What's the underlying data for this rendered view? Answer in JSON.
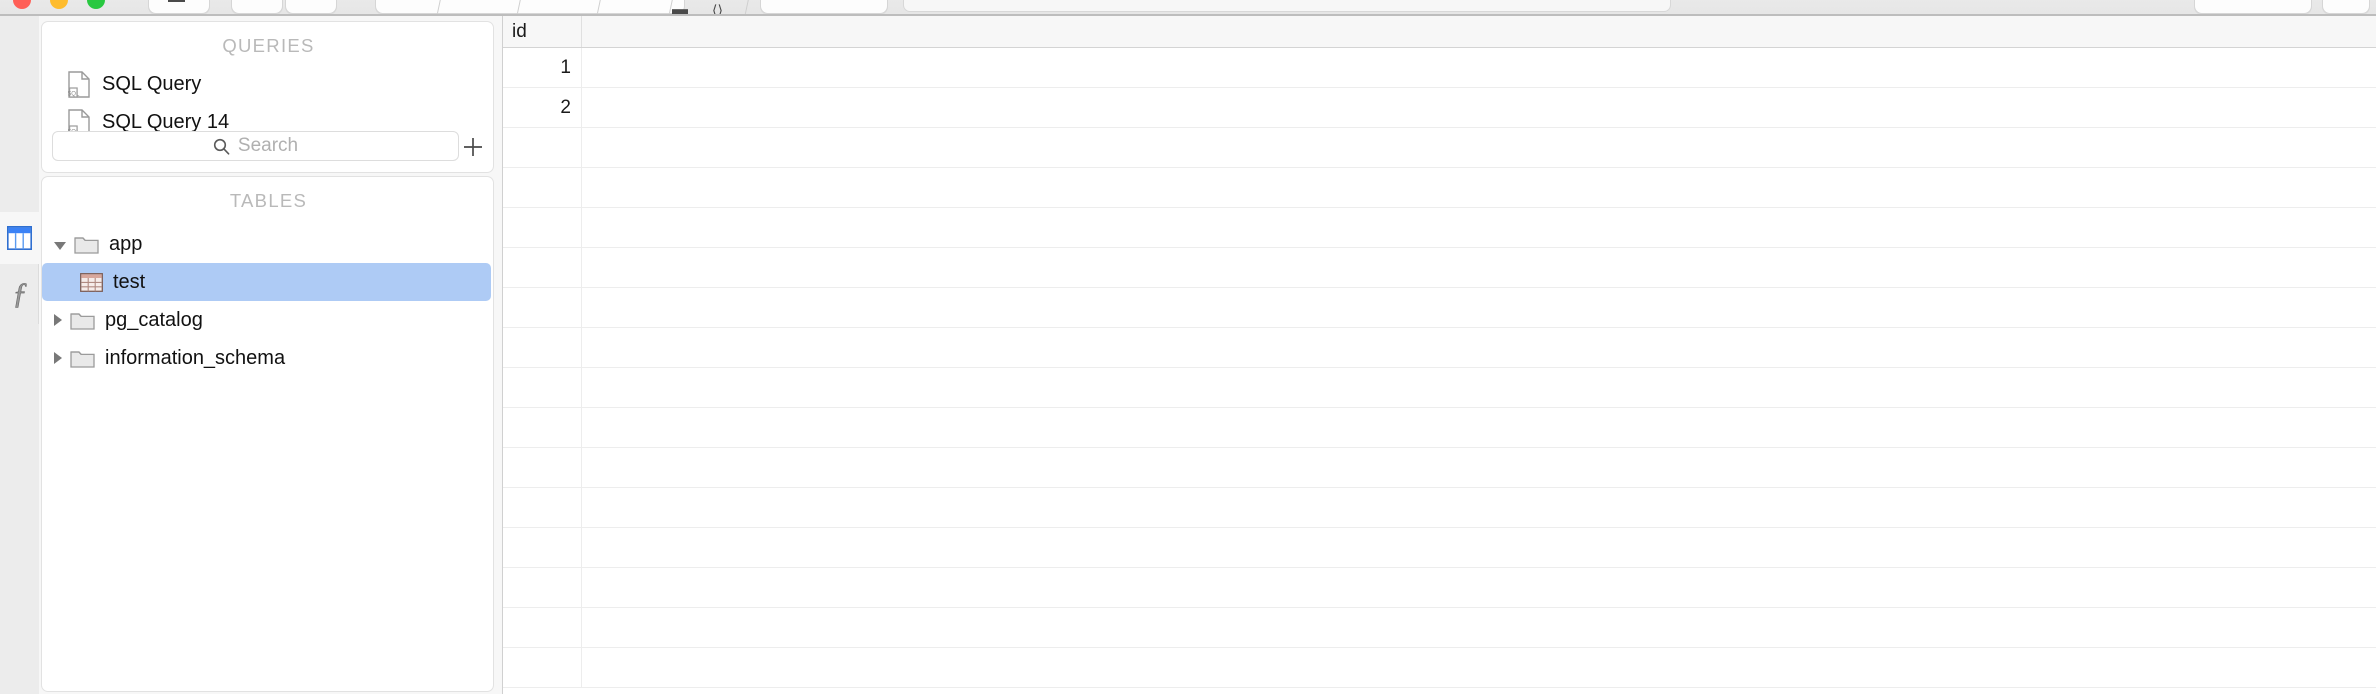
{
  "window": {
    "traffic_lights": [
      "close",
      "minimize",
      "zoom"
    ],
    "toolbar_items": [
      {
        "name": "sidebar-toggle",
        "glyph": "▭"
      },
      {
        "name": "nav-back",
        "glyph": "‹"
      },
      {
        "name": "nav-forward",
        "glyph": "›"
      },
      {
        "name": "view-table",
        "glyph": "⊞"
      },
      {
        "name": "structure",
        "glyph": "◎"
      },
      {
        "name": "relations",
        "glyph": "◆"
      },
      {
        "name": "content",
        "glyph": "▤"
      },
      {
        "name": "query-expand",
        "glyph": "⟨⟩"
      },
      {
        "name": "console",
        "glyph": "▬"
      },
      {
        "name": "filter",
        "glyph": "⌄"
      },
      {
        "name": "sort",
        "glyph": "⬤"
      },
      {
        "name": "refresh",
        "glyph": "▬"
      },
      {
        "name": "more",
        "glyph": "⌄"
      }
    ]
  },
  "rail": {
    "items": [
      {
        "name": "tables-tab",
        "icon": "grid-icon",
        "selected": true
      },
      {
        "name": "functions-tab",
        "icon": "function-f-icon",
        "selected": false
      }
    ]
  },
  "sidebar": {
    "queries": {
      "title": "QUERIES",
      "items": [
        {
          "label": "SQL Query",
          "icon": "sql-file-icon"
        },
        {
          "label": "SQL Query 14",
          "icon": "sql-file-icon"
        }
      ],
      "search": {
        "placeholder": "Search",
        "value": "",
        "icon": "search-icon"
      },
      "add_button": {
        "label": "+",
        "icon": "plus-icon"
      }
    },
    "tables": {
      "title": "TABLES",
      "tree": [
        {
          "label": "app",
          "type": "schema",
          "icon": "folder-icon",
          "expanded": true,
          "indent": 0,
          "selected": false
        },
        {
          "label": "test",
          "type": "table",
          "icon": "table-icon",
          "expanded": null,
          "indent": 1,
          "selected": true
        },
        {
          "label": "pg_catalog",
          "type": "schema",
          "icon": "folder-icon",
          "expanded": false,
          "indent": 0,
          "selected": false
        },
        {
          "label": "information_schema",
          "type": "schema",
          "icon": "folder-icon",
          "expanded": false,
          "indent": 0,
          "selected": false
        }
      ]
    }
  },
  "grid": {
    "columns": [
      "id",
      ""
    ],
    "rows": [
      [
        "1",
        ""
      ],
      [
        "2",
        ""
      ],
      [
        "",
        ""
      ],
      [
        "",
        ""
      ],
      [
        "",
        ""
      ],
      [
        "",
        ""
      ],
      [
        "",
        ""
      ],
      [
        "",
        ""
      ],
      [
        "",
        ""
      ],
      [
        "",
        ""
      ],
      [
        "",
        ""
      ],
      [
        "",
        ""
      ],
      [
        "",
        ""
      ],
      [
        "",
        ""
      ],
      [
        "",
        ""
      ],
      [
        "",
        ""
      ]
    ]
  },
  "colors": {
    "selection": "#aecbf5",
    "accent": "#3b82f6",
    "chrome": "#ececec",
    "panel": "#ffffff",
    "muted_text": "#b9b9b9"
  }
}
